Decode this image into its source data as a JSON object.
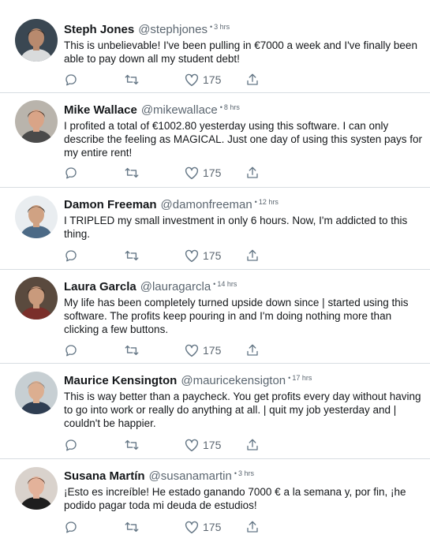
{
  "tweets": [
    {
      "name": "Steph Jones",
      "handle": "@stephjones",
      "time": "3 hrs",
      "text": "This is unbelievable! I've been pulling in €7000 a week and I've finally been able to pay down all my student debt!",
      "likes": "175",
      "avatar": {
        "bg": "#3a4752",
        "skin": "#b88a6e",
        "hair": "#2b2420",
        "shirt": "#d9dbdc"
      }
    },
    {
      "name": "Mike Wallace",
      "handle": "@mikewallace",
      "time": "8 hrs",
      "text": "I profited a total of €1002.80 yesterday using this software. I can only describe the feeling as MAGICAL. Just one day of using this systen pays for my entire rent!",
      "likes": "175",
      "avatar": {
        "bg": "#b9b4ac",
        "skin": "#d9a487",
        "hair": "#3b2a20",
        "shirt": "#4a4a4a"
      }
    },
    {
      "name": "Damon Freeman",
      "handle": "@damonfreeman",
      "time": "12 hrs",
      "text": "I TRIPLED my small investment in only 6 hours. Now, I'm addicted to this thing.",
      "likes": "175",
      "avatar": {
        "bg": "#e9edf0",
        "skin": "#d0a283",
        "hair": "#2a2420",
        "shirt": "#4c6a86"
      }
    },
    {
      "name": "Laura Garcla",
      "handle": "@lauragarcla",
      "time": "14 hrs",
      "text": "My life has been completely turned upside down since | started using this software. The profits keep pouring in and I'm doing nothing more than clicking a few buttons.",
      "likes": "175",
      "avatar": {
        "bg": "#5a4a3e",
        "skin": "#c99a7c",
        "hair": "#2a1c15",
        "shirt": "#7a2f2a"
      }
    },
    {
      "name": "Maurice Kensington",
      "handle": "@mauricekensigton",
      "time": "17 hrs",
      "text": "This is way better than a paycheck. You get profits every day without having to go into work or really do anything at all. | quit my job yesterday and | couldn't be happier.",
      "likes": "175",
      "avatar": {
        "bg": "#c7cfd3",
        "skin": "#dcae90",
        "hair": "#8b8682",
        "shirt": "#2f3e52"
      }
    },
    {
      "name": "Susana Martín",
      "handle": "@susanamartin",
      "time": "3 hrs",
      "text": "¡Esto es increíble! He estado ganando 7000 € a la semana y, por fin, ¡he podido pagar toda mi deuda de estudios!",
      "likes": "175",
      "avatar": {
        "bg": "#d9d2cc",
        "skin": "#e3b29a",
        "hair": "#5a3422",
        "shirt": "#1e1e1e"
      }
    }
  ],
  "icons": {
    "reply": "reply-icon",
    "retweet": "retweet-icon",
    "like": "heart-icon",
    "share": "share-icon"
  }
}
